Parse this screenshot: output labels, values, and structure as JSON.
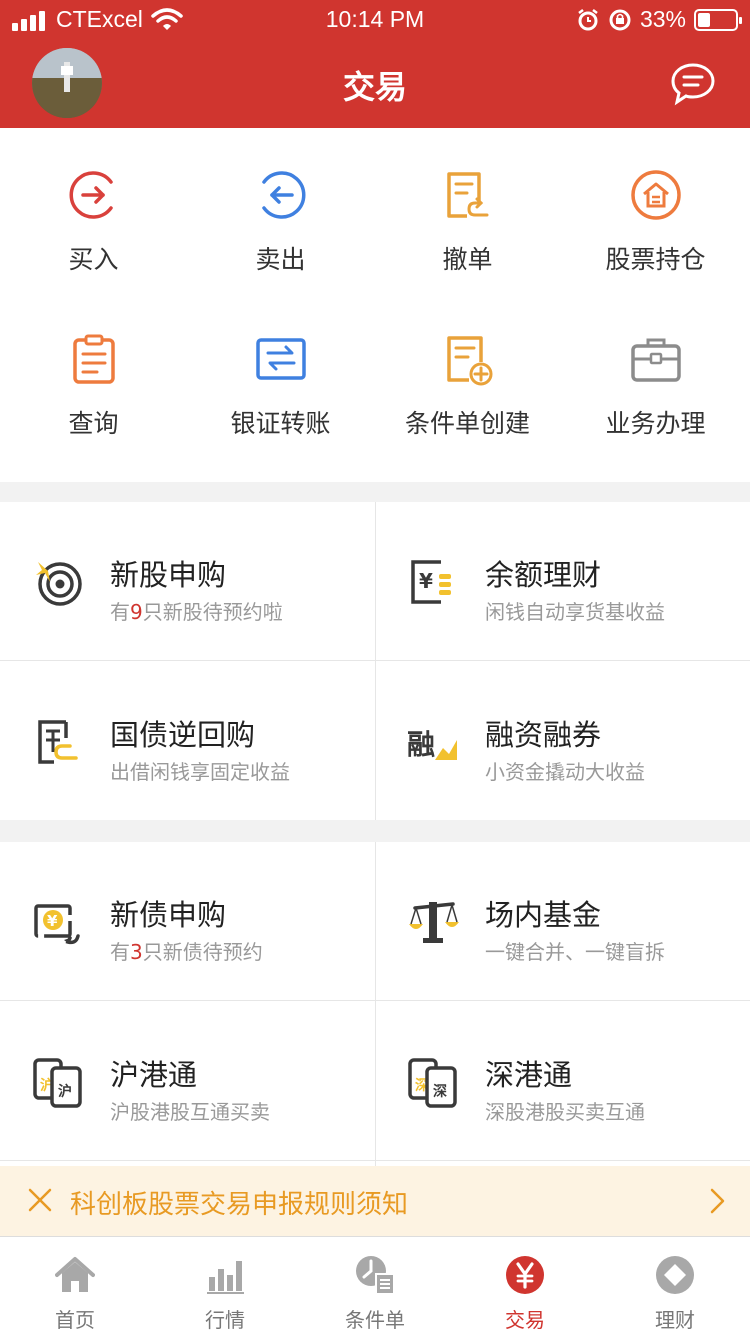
{
  "status_bar": {
    "carrier": "CTExcel",
    "time": "10:14 PM",
    "battery": "33%",
    "battery_level": 0.33
  },
  "header": {
    "title": "交易"
  },
  "quick_actions": [
    {
      "label": "买入",
      "icon": "buy-icon"
    },
    {
      "label": "卖出",
      "icon": "sell-icon"
    },
    {
      "label": "撤单",
      "icon": "cancel-order-icon"
    },
    {
      "label": "股票持仓",
      "icon": "holdings-icon"
    },
    {
      "label": "查询",
      "icon": "query-icon"
    },
    {
      "label": "银证转账",
      "icon": "transfer-icon"
    },
    {
      "label": "条件单创建",
      "icon": "create-conditional-order-icon"
    },
    {
      "label": "业务办理",
      "icon": "business-icon"
    }
  ],
  "services": {
    "ipo": {
      "name": "新股申购",
      "desc_prefix": "有",
      "desc_num": "9",
      "desc_suffix": "只新股待预约啦"
    },
    "balance": {
      "name": "余额理财",
      "desc": "闲钱自动享货基收益"
    },
    "repo": {
      "name": "国债逆回购",
      "desc": "出借闲钱享固定收益"
    },
    "margin": {
      "name": "融资融券",
      "desc": "小资金撬动大收益"
    },
    "bond": {
      "name": "新债申购",
      "desc_prefix": "有",
      "desc_num": "3",
      "desc_suffix": "只新债待预约"
    },
    "fund": {
      "name": "场内基金",
      "desc": "一键合并、一键盲拆"
    },
    "sh_hk": {
      "name": "沪港通",
      "desc": "沪股港股互通买卖"
    },
    "sz_hk": {
      "name": "深港通",
      "desc": "深股港股买卖互通"
    }
  },
  "notice": {
    "text": "科创板股票交易申报规则须知"
  },
  "tabs": [
    {
      "label": "首页",
      "icon": "home-icon"
    },
    {
      "label": "行情",
      "icon": "market-icon"
    },
    {
      "label": "条件单",
      "icon": "conditional-order-icon"
    },
    {
      "label": "交易",
      "icon": "trade-yen-icon",
      "active": true
    },
    {
      "label": "理财",
      "icon": "wealth-icon"
    }
  ],
  "colors": {
    "brand": "#d0352f",
    "notice_text": "#e89a23",
    "notice_bg": "#fdf3e2"
  }
}
